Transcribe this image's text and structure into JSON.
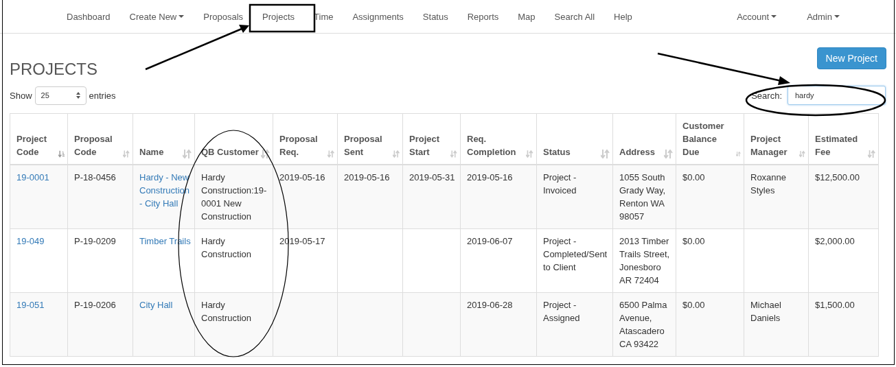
{
  "nav": {
    "items": [
      {
        "label": "Dashboard",
        "dropdown": false
      },
      {
        "label": "Create New",
        "dropdown": true
      },
      {
        "label": "Proposals",
        "dropdown": false
      },
      {
        "label": "Projects",
        "dropdown": false
      },
      {
        "label": "Time",
        "dropdown": false
      },
      {
        "label": "Assignments",
        "dropdown": false
      },
      {
        "label": "Status",
        "dropdown": false
      },
      {
        "label": "Reports",
        "dropdown": false
      },
      {
        "label": "Map",
        "dropdown": false
      },
      {
        "label": "Search All",
        "dropdown": false
      },
      {
        "label": "Help",
        "dropdown": false
      }
    ],
    "right_items": [
      {
        "label": "Account",
        "dropdown": true
      },
      {
        "label": "Admin",
        "dropdown": true
      }
    ]
  },
  "page_title": "PROJECTS",
  "new_button": "New Project",
  "length": {
    "before": "Show",
    "value": "25",
    "after": "entries"
  },
  "search": {
    "label": "Search:",
    "value": "hardy"
  },
  "table": {
    "columns": [
      {
        "label": "Project Code",
        "sorted": true,
        "link": true
      },
      {
        "label": "Proposal Code",
        "sorted": false,
        "link": false
      },
      {
        "label": "Name",
        "sorted": false,
        "link": true
      },
      {
        "label": "QB Customer",
        "sorted": false,
        "link": false
      },
      {
        "label": "Proposal Req.",
        "sorted": false,
        "link": false
      },
      {
        "label": "Proposal Sent",
        "sorted": false,
        "link": false
      },
      {
        "label": "Project Start",
        "sorted": false,
        "link": false
      },
      {
        "label": "Req. Completion",
        "sorted": false,
        "link": false
      },
      {
        "label": "Status",
        "sorted": false,
        "link": false
      },
      {
        "label": "Address",
        "sorted": false,
        "link": false
      },
      {
        "label": "Customer Balance Due",
        "sorted": false,
        "link": false
      },
      {
        "label": "Project Manager",
        "sorted": false,
        "link": false
      },
      {
        "label": "Estimated Fee",
        "sorted": false,
        "link": false
      }
    ],
    "rows": [
      [
        "19-0001",
        "P-18-0456",
        "Hardy - New Construction - City Hall",
        "Hardy Construction:19-0001 New Construction",
        "2019-05-16",
        "2019-05-16",
        "2019-05-31",
        "2019-05-16",
        "Project - Invoiced",
        "1055 South Grady Way, Renton WA 98057",
        "$0.00",
        "Roxanne Styles",
        "$12,500.00"
      ],
      [
        "19-049",
        "P-19-0209",
        "Timber Trails",
        "Hardy Construction",
        "2019-05-17",
        "",
        "",
        "2019-06-07",
        "Project - Completed/Sent to Client",
        "2013 Timber Trails Street, Jonesboro AR 72404",
        "$0.00",
        "",
        "$2,000.00"
      ],
      [
        "19-051",
        "P-19-0206",
        "City Hall",
        "Hardy Construction",
        "",
        "",
        "",
        "2019-06-28",
        "Project - Assigned",
        "6500 Palma Avenue, Atascadero CA 93422",
        "$0.00",
        "Michael Daniels",
        "$1,500.00"
      ]
    ]
  },
  "annotations": [
    {
      "kind": "box"
    },
    {
      "kind": "arrow"
    },
    {
      "kind": "arrow"
    },
    {
      "kind": "ellipse"
    },
    {
      "kind": "ellipse"
    }
  ]
}
